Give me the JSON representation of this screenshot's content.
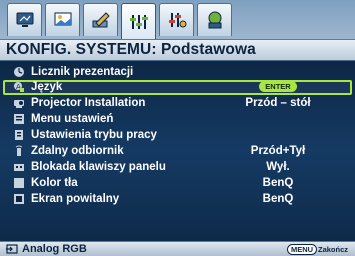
{
  "colors": {
    "selection": "#a9e640",
    "panel_bg": "#0e2a4a",
    "title_bg": "#dfe7ef",
    "text": "#ffffff"
  },
  "tabs": [
    {
      "icon": "display-icon",
      "active": false
    },
    {
      "icon": "picture-icon",
      "active": false
    },
    {
      "icon": "pencil-icon",
      "active": false
    },
    {
      "icon": "settings-icon",
      "active": true
    },
    {
      "icon": "advanced-settings-icon",
      "active": false
    },
    {
      "icon": "info-icon",
      "active": false
    }
  ],
  "header": {
    "title": "KONFIG. SYSTEMU: Podstawowa"
  },
  "menu": {
    "items": [
      {
        "icon": "timer-icon",
        "label": "Licznik prezentacji",
        "value": ""
      },
      {
        "icon": "language-icon",
        "label": "Język",
        "value": "ENTER",
        "selected": true
      },
      {
        "icon": "projector-icon",
        "label": "Projector Installation",
        "value": "Przód – stół"
      },
      {
        "icon": "menu-settings-icon",
        "label": "Menu ustawień",
        "value": ""
      },
      {
        "icon": "operation-settings-icon",
        "label": "Ustawienia trybu pracy",
        "value": ""
      },
      {
        "icon": "remote-icon",
        "label": "Zdalny odbiornik",
        "value": "Przód+Tył"
      },
      {
        "icon": "keypad-lock-icon",
        "label": "Blokada klawiszy panelu",
        "value": "Wył."
      },
      {
        "icon": "background-color-icon",
        "label": "Kolor tła",
        "value": "BenQ"
      },
      {
        "icon": "splash-screen-icon",
        "label": "Ekran powitalny",
        "value": "BenQ"
      }
    ]
  },
  "statusbar": {
    "source_icon": "input-source-icon",
    "source": "Analog RGB",
    "menu_key": "MENU",
    "exit_label": "Zakończ"
  }
}
